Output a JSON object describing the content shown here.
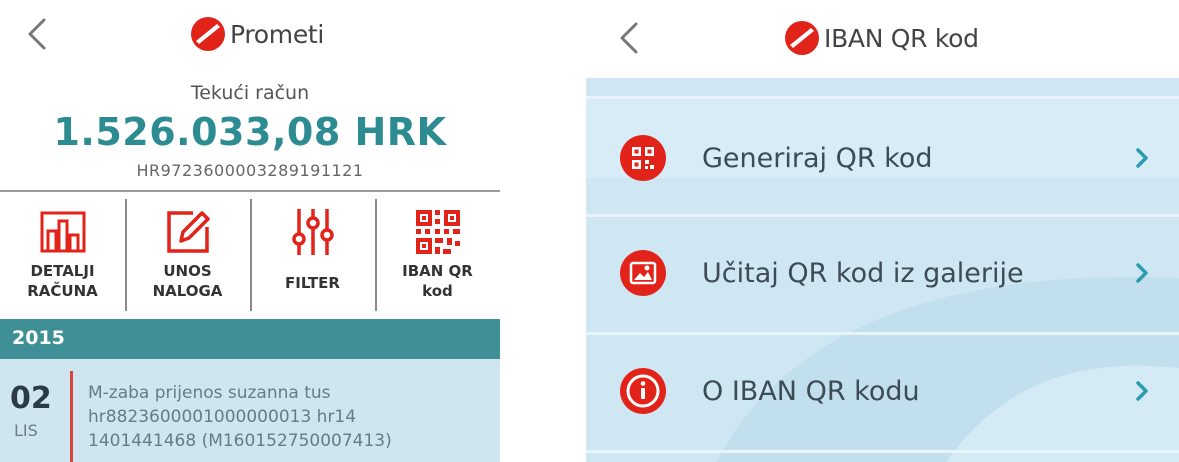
{
  "colors": {
    "brand_red": "#e2231a",
    "teal_amount": "#2d8c92",
    "year_bar": "#3f8f96",
    "transaction_bg": "#cfe6f1",
    "menu_bg": "#cfe7f3",
    "chevron_teal": "#2a9bb0"
  },
  "left_screen": {
    "header": {
      "title": "Prometi",
      "back_icon": "chevron-left-icon",
      "logo_icon": "brand-logo-icon"
    },
    "account": {
      "label": "Tekući račun",
      "amount": "1.526.033,08 HRK",
      "iban": "HR9723600003289191121"
    },
    "actions": [
      {
        "icon": "chart-icon",
        "label": "DETALJI\nRAČUNA"
      },
      {
        "icon": "edit-icon",
        "label": "UNOS\nNALOGA"
      },
      {
        "icon": "sliders-icon",
        "label": "FILTER"
      },
      {
        "icon": "qr-code-icon",
        "label": "IBAN QR\nkod"
      }
    ],
    "year": "2015",
    "transaction": {
      "day": "02",
      "month": "LIS",
      "description": "M-zaba prijenos suzanna tus\nhr8823600001000000013 hr14\n1401441468 (M160152750007413)"
    }
  },
  "right_screen": {
    "header": {
      "title": "IBAN QR kod",
      "back_icon": "chevron-left-icon",
      "logo_icon": "brand-logo-icon"
    },
    "menu": [
      {
        "icon": "qr-code-icon",
        "label": "Generiraj QR kod"
      },
      {
        "icon": "gallery-image-icon",
        "label": "Učitaj QR kod iz galerije"
      },
      {
        "icon": "info-icon",
        "label": "O IBAN QR kodu"
      }
    ]
  }
}
